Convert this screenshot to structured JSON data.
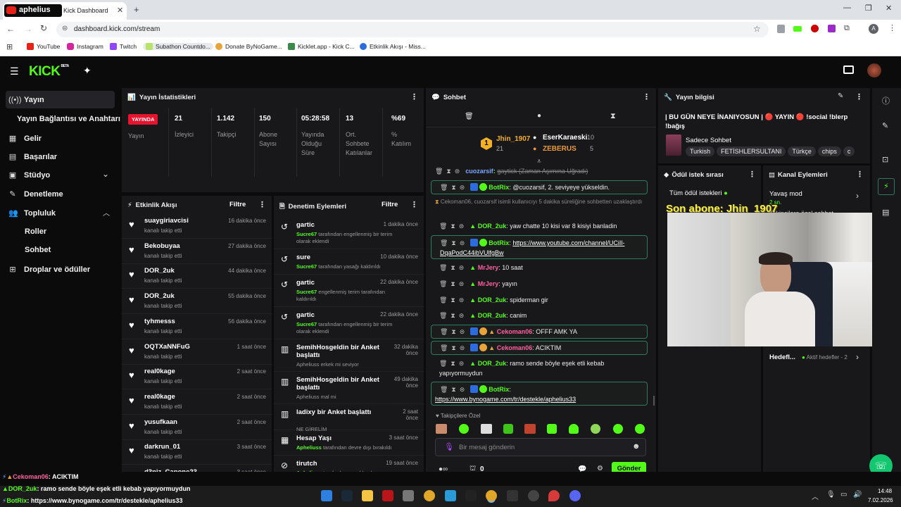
{
  "browser": {
    "tab_title": "Kick Dashboard",
    "tab_overlay_name": "aphelius",
    "url": "dashboard.kick.com/stream",
    "bookmarks": [
      "YouTube",
      "Instagram",
      "Twitch",
      "Subathon Countdo...",
      "Donate ByNoGame...",
      "Kicklet.app - Kick C...",
      "Etkinlik Akışı - Miss..."
    ]
  },
  "kick": {
    "logo": "KICK",
    "logo_sup": "BETA"
  },
  "sidebar": {
    "items": [
      {
        "label": "Yayın",
        "icon": "broadcast-icon"
      },
      {
        "label": "Yayın Bağlantısı ve Anahtarı",
        "icon": ""
      },
      {
        "label": "Gelir",
        "icon": "revenue-icon"
      },
      {
        "label": "Başarılar",
        "icon": "achievements-icon"
      },
      {
        "label": "Stüdyo",
        "icon": "studio-icon"
      },
      {
        "label": "Denetleme",
        "icon": "wrench-icon"
      },
      {
        "label": "Topluluk",
        "icon": "community-icon"
      },
      {
        "label": "Roller",
        "icon": ""
      },
      {
        "label": "Sohbet",
        "icon": ""
      },
      {
        "label": "Droplar ve ödüller",
        "icon": "drops-icon"
      }
    ]
  },
  "stats": {
    "title": "Yayın İstatistikleri",
    "live_badge": "YAYINDA",
    "live_label": "Yayın",
    "items": [
      {
        "value": "21",
        "label": "İzleyici"
      },
      {
        "value": "1.142",
        "label": "Takipçi"
      },
      {
        "value": "150",
        "label": "Abone Sayısı"
      },
      {
        "value": "05:28:58",
        "label": "Yayında Olduğu Süre"
      },
      {
        "value": "13",
        "label": "Ort. Sohbete Katılanlar"
      },
      {
        "value": "%69",
        "label": "% Katılım"
      }
    ]
  },
  "events": {
    "title": "Etkinlik Akışı",
    "filter": "Filtre",
    "items": [
      {
        "name": "suaygiriavcisi",
        "sub": "kanalı takip etti",
        "time": "16 dakika önce"
      },
      {
        "name": "Bekobuyaa",
        "sub": "kanalı takip etti",
        "time": "27 dakika önce"
      },
      {
        "name": "DOR_2uk",
        "sub": "kanalı takip etti",
        "time": "44 dakika önce"
      },
      {
        "name": "DOR_2uk",
        "sub": "kanalı takip etti",
        "time": "55 dakika önce"
      },
      {
        "name": "tyhmesss",
        "sub": "kanalı takip etti",
        "time": "56 dakika önce"
      },
      {
        "name": "OQTXaNNFuG",
        "sub": "kanalı takip etti",
        "time": "1 saat önce"
      },
      {
        "name": "real0kage",
        "sub": "kanalı takip etti",
        "time": "2 saat önce"
      },
      {
        "name": "real0kage",
        "sub": "kanalı takip etti",
        "time": "2 saat önce"
      },
      {
        "name": "yusufkaan",
        "sub": "kanalı takip etti",
        "time": "2 saat önce"
      },
      {
        "name": "darkrun_01",
        "sub": "kanalı takip etti",
        "time": "3 saat önce"
      },
      {
        "name": "d3niz_Capone23",
        "sub": "",
        "time": "3 saat önce"
      }
    ]
  },
  "mod": {
    "title": "Denetim Eylemleri",
    "filter": "Filtre",
    "items": [
      {
        "name": "gartic",
        "actor": "Sucre67",
        "sub": "tarafından engellenmiş bir terim olarak eklendi",
        "time": "1 dakika önce"
      },
      {
        "name": "sure",
        "actor": "Sucre67",
        "sub": "tarafından yasağı kaldırıldı",
        "time": "10 dakika önce"
      },
      {
        "name": "gartic",
        "actor": "Sucre67",
        "sub": "engellenmiş terim  tarafından kaldırıldı",
        "time": "22 dakika önce"
      },
      {
        "name": "gartic",
        "actor": "Sucre67",
        "sub": "tarafından engellenmiş bir terim olarak eklendi",
        "time": "22 dakika önce"
      },
      {
        "name": "SemihHosgeldin bir Anket başlattı",
        "actor": "",
        "sub": "Apheliuss erkek mi seviyor",
        "time": "32 dakika önce"
      },
      {
        "name": "SemihHosgeldin bir Anket başlattı",
        "actor": "",
        "sub": "Apheliuss mal mi",
        "time": "49 dakika önce"
      },
      {
        "name": "ladixy bir Anket başlattı",
        "actor": "",
        "sub": "NE GİRELİM",
        "time": "2 saat önce"
      },
      {
        "name": "Hesap Yaşı",
        "actor": "Apheliuss",
        "sub": "tarafından devre dışı bırakıldı",
        "time": "3 saat önce"
      },
      {
        "name": "tirutch",
        "actor": "Apheliuss",
        "sub": "tarafından yasaklandı",
        "time": "19 saat önce"
      }
    ]
  },
  "chat": {
    "title": "Sohbet",
    "top_gifter": "Jhin_1907",
    "top_gifter_count": "21",
    "second": "EserKaraeski",
    "second_count": "10",
    "third": "ZEBERUS",
    "third_count": "5",
    "messages": [
      {
        "user": "cuozarsif",
        "text": "gaytick (Zaman Aşımına Uğradı)"
      },
      {
        "user": "BotRix",
        "text": "@cuozarsif, 2. seviyeye yükseldin."
      },
      {
        "user": "",
        "text": "Cekoman06, cuozarsif isimli kullanıcıyı 5 dakika süreliğine sohbetten uzaklaştırdı"
      },
      {
        "user": "DOR_2uk",
        "text": "yaw chatte 10 kisi var 8 kisiyi banladin"
      },
      {
        "user": "BotRix",
        "text": "https://www.youtube.com/channel/UCiIl-DqaPodC44ibVUlfgBw"
      },
      {
        "user": "MrJery",
        "text": "10 saat"
      },
      {
        "user": "MrJery",
        "text": "yayın"
      },
      {
        "user": "DOR_2uk",
        "text": "spiderman gir"
      },
      {
        "user": "DOR_2uk",
        "text": "canim"
      },
      {
        "user": "Cekoman06",
        "text": "OFFF AMK YA"
      },
      {
        "user": "Cekoman06",
        "text": "ACIKTIM"
      },
      {
        "user": "DOR_2uk",
        "text": "ramo sende böyle eşek etli kebab yapıyormuydun"
      },
      {
        "user": "BotRix",
        "text": "https://www.bynogame.com/tr/destekle/aphelius33"
      }
    ],
    "followers_only": "Takipçilere Özel",
    "input_placeholder": "Bir mesaj gönderin",
    "points": "0",
    "send": "Gönder"
  },
  "info": {
    "title": "Yayın bilgisi",
    "stream_title": "| BU GÜN NEYE İNANIYOSUN | 🔴 YAYIN 🔴 !social !blerp !bağış",
    "category": "Sadece Sohbet",
    "tags": [
      "Turkish",
      "FETİSHLERSULTANI",
      "Türkçe",
      "chips",
      "c"
    ]
  },
  "rewards": {
    "title": "Ödül istek sırası",
    "all": "Tüm ödül istekleri",
    "overlay": "Son abone: Jhin_1907"
  },
  "channel": {
    "title": "Kanal Eylemleri",
    "slow": "Yavaş mod",
    "slow_sub": "2 sn.",
    "hidden_text": "Takipçilere özel sohbet",
    "goals": "Hedefl...",
    "goals_sub": "Aktif hedefler - 2"
  },
  "status": {
    "lines": [
      {
        "user": "Cekoman06",
        "text": ": ACIKTIM"
      },
      {
        "user": "DOR_2uk",
        "text": ": ramo sende böyle eşek etli kebab yapıyormuydun"
      },
      {
        "user": "BotRix",
        "text": ": https://www.bynogame.com/tr/destekle/aphelius33"
      }
    ]
  },
  "taskbar": {
    "time": "14:48",
    "date": "7.02.2026"
  }
}
